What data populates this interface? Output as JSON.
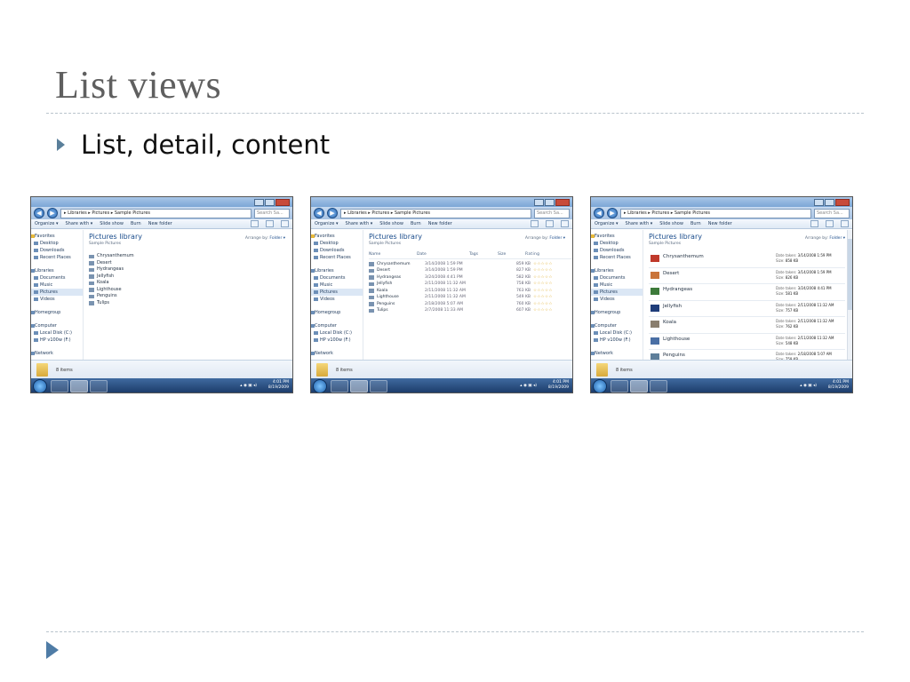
{
  "slide": {
    "title": "List views",
    "bullet": "List, detail, content"
  },
  "explorer": {
    "address": "▸ Libraries ▸ Pictures ▸ Sample Pictures",
    "search_placeholder": "Search Sa...",
    "toolbar": {
      "organize": "Organize ▾",
      "share_with": "Share with ▾",
      "slide_show": "Slide show",
      "burn": "Burn",
      "new_folder": "New folder"
    },
    "nav": {
      "favorites": "Favorites",
      "desktop": "Desktop",
      "downloads": "Downloads",
      "recent_places": "Recent Places",
      "libraries": "Libraries",
      "documents": "Documents",
      "music": "Music",
      "pictures": "Pictures",
      "videos": "Videos",
      "homegroup": "Homegroup",
      "computer": "Computer",
      "local_disk": "Local Disk (C:)",
      "hp_drive": "HP v100w (F:)",
      "network": "Network"
    },
    "library_title": "Pictures library",
    "library_subtitle": "Sample Pictures",
    "arrange_label": "Arrange by:",
    "arrange_value": "Folder ▾",
    "status_count": "8 items",
    "clock_time": "4:01 PM",
    "clock_date": "8/19/2009",
    "tray": "▴ ◉ ▣ ◂)"
  },
  "files": [
    {
      "name": "Chrysanthemum",
      "date": "3/14/2008 1:59 PM",
      "size": "859 KB",
      "content_date": "3/14/2008 1:59 PM",
      "content_size": "858 KB",
      "color": "#c0392b"
    },
    {
      "name": "Desert",
      "date": "3/14/2008 1:59 PM",
      "size": "827 KB",
      "content_date": "3/14/2008 1:59 PM",
      "content_size": "826 KB",
      "color": "#c9743a"
    },
    {
      "name": "Hydrangeas",
      "date": "3/24/2008 4:41 PM",
      "size": "582 KB",
      "content_date": "3/24/2008 4:41 PM",
      "content_size": "581 KB",
      "color": "#3d7a3a"
    },
    {
      "name": "Jellyfish",
      "date": "2/11/2008 11:32 AM",
      "size": "758 KB",
      "content_date": "2/11/2008 11:32 AM",
      "content_size": "757 KB",
      "color": "#1f3d7a"
    },
    {
      "name": "Koala",
      "date": "2/11/2008 11:32 AM",
      "size": "763 KB",
      "content_date": "2/11/2008 11:32 AM",
      "content_size": "762 KB",
      "color": "#8a7e6e"
    },
    {
      "name": "Lighthouse",
      "date": "2/11/2008 11:32 AM",
      "size": "549 KB",
      "content_date": "2/11/2008 11:32 AM",
      "content_size": "548 KB",
      "color": "#4a6fa5"
    },
    {
      "name": "Penguins",
      "date": "2/18/2008 5:07 AM",
      "size": "760 KB",
      "content_date": "2/18/2008 5:07 AM",
      "content_size": "759 KB",
      "color": "#5f7f9a"
    },
    {
      "name": "Tulips",
      "date": "2/7/2008 11:33 AM",
      "size": "607 KB",
      "content_date": "2/7/2008 11:33 AM",
      "content_size": "",
      "color": "#d4a62a"
    }
  ],
  "detail_headers": {
    "name": "Name",
    "date": "Date",
    "tags": "Tags",
    "size": "Size",
    "rating": "Rating"
  },
  "rating_stars": "☆☆☆☆☆",
  "content_labels": {
    "date_taken": "Date taken:",
    "size": "Size:"
  }
}
